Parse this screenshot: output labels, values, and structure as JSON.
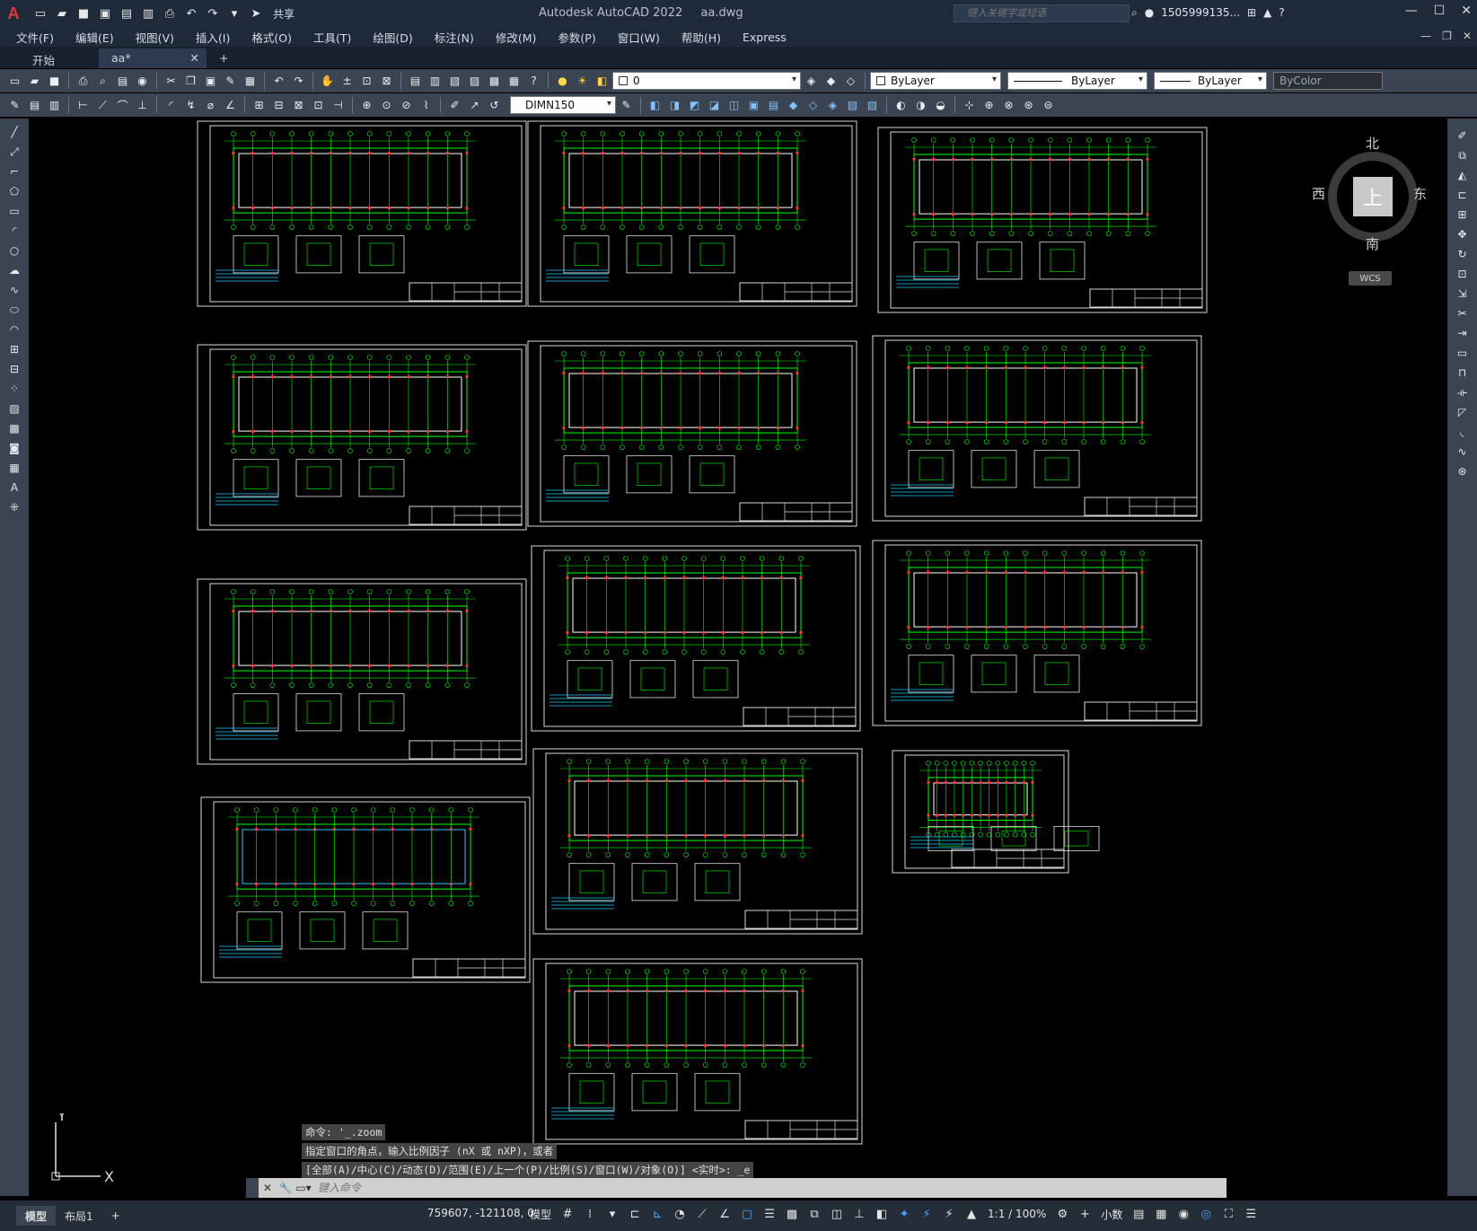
{
  "app": {
    "title": "Autodesk AutoCAD 2022",
    "file": "aa.dwg",
    "search_placeholder": "键入关键字或短语",
    "user": "1505999135...",
    "share_label": "共享"
  },
  "menu": [
    "文件(F)",
    "编辑(E)",
    "视图(V)",
    "插入(I)",
    "格式(O)",
    "工具(T)",
    "绘图(D)",
    "标注(N)",
    "修改(M)",
    "参数(P)",
    "窗口(W)",
    "帮助(H)",
    "Express"
  ],
  "tabs": {
    "start": "开始",
    "doc": "aa*",
    "close": "✕",
    "add": "+"
  },
  "toolbar": {
    "layer_value": "0",
    "color_value": "ByLayer",
    "linetype_value": "ByLayer",
    "lineweight_value": "ByLayer",
    "plotstyle_value": "ByColor",
    "dimstyle_value": "DIMN150"
  },
  "viewcube": {
    "north": "北",
    "south": "南",
    "east": "东",
    "west": "西",
    "top": "上",
    "wcs": "WCS"
  },
  "ucs": {
    "x": "X",
    "y": "Y"
  },
  "command": {
    "history": [
      "命令: '_.zoom",
      "指定窗口的角点，输入比例因子 (nX 或 nXP)，或者",
      "[全部(A)/中心(C)/动态(D)/范围(E)/上一个(P)/比例(S)/窗口(W)/对象(O)] <实时>: _e"
    ],
    "placeholder": "键入命令"
  },
  "status": {
    "model_tab": "模型",
    "layout_tab": "布局1",
    "add_tab": "+",
    "coords": "759607, -121108, 0",
    "space": "模型",
    "scale": "1:1 / 100%",
    "units": "小数"
  },
  "colors": {
    "title_bg": "#1e2a3a",
    "toolbar_bg": "#3b4453",
    "canvas": "#000000",
    "drawing_green": "#00ff00"
  }
}
